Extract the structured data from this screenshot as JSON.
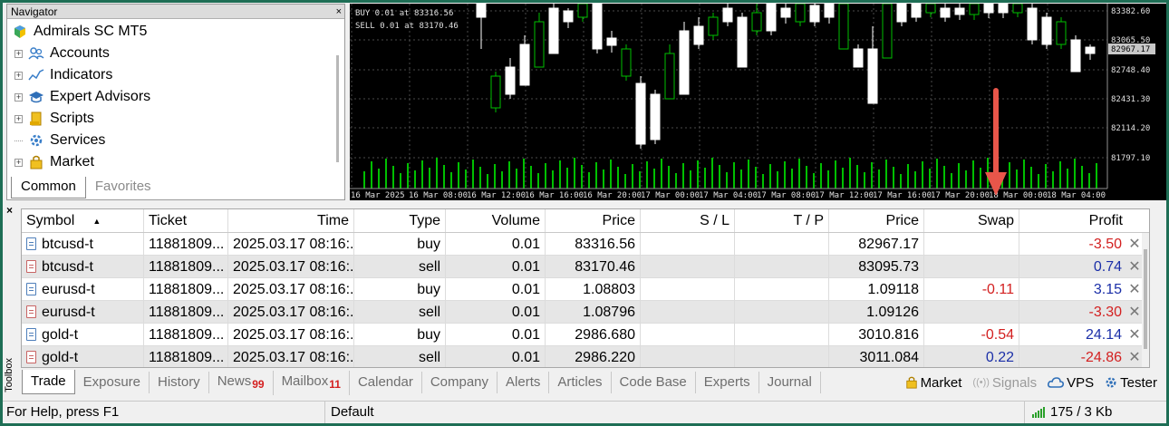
{
  "navigator": {
    "title": "Navigator",
    "close": "×",
    "root": "Admirals SC MT5",
    "items": [
      {
        "label": "Accounts",
        "icon": "accounts-icon"
      },
      {
        "label": "Indicators",
        "icon": "indicators-icon"
      },
      {
        "label": "Expert Advisors",
        "icon": "expert-advisors-icon"
      },
      {
        "label": "Scripts",
        "icon": "scripts-icon"
      },
      {
        "label": "Services",
        "icon": "services-icon"
      },
      {
        "label": "Market",
        "icon": "market-icon"
      }
    ],
    "tabs": [
      "Common",
      "Favorites"
    ]
  },
  "chart": {
    "orders": [
      "BUY 0.01 at 83316.56",
      "SELL 0.01 at 83170.46"
    ],
    "price_labels": [
      "83382.60",
      "83065.50",
      "82967.17",
      "82748.40",
      "82431.30",
      "82114.20",
      "81797.10"
    ],
    "time_labels": [
      "16 Mar 2025",
      "16 Mar 08:00",
      "16 Mar 12:00",
      "16 Mar 16:00",
      "16 Mar 20:00",
      "17 Mar 00:00",
      "17 Mar 04:00",
      "17 Mar 08:00",
      "17 Mar 12:00",
      "17 Mar 16:00",
      "17 Mar 20:00",
      "18 Mar 00:00",
      "18 Mar 04:00"
    ],
    "colors": {
      "bull": "#00c000",
      "bear": "#ffffff",
      "grid": "#4a4a4a",
      "arrow": "#e8564a"
    }
  },
  "toolbox": {
    "label": "Toolbox",
    "close": "×"
  },
  "trade": {
    "headers": {
      "symbol": "Symbol",
      "ticket": "Ticket",
      "time": "Time",
      "type": "Type",
      "volume": "Volume",
      "price": "Price",
      "sl": "S / L",
      "tp": "T / P",
      "current_price": "Price",
      "swap": "Swap",
      "profit": "Profit"
    },
    "sort_icon": "▲",
    "close_icon": "✕",
    "rows": [
      {
        "symbol": "btcusd-t",
        "ticket": "11881809...",
        "time": "2025.03.17 08:16:...",
        "type": "buy",
        "volume": "0.01",
        "price": "83316.56",
        "sl": "",
        "tp": "",
        "current": "82967.17",
        "swap": "",
        "swap_sign": "",
        "profit": "-3.50",
        "profit_sign": "neg"
      },
      {
        "symbol": "btcusd-t",
        "ticket": "11881809...",
        "time": "2025.03.17 08:16:...",
        "type": "sell",
        "volume": "0.01",
        "price": "83170.46",
        "sl": "",
        "tp": "",
        "current": "83095.73",
        "swap": "",
        "swap_sign": "",
        "profit": "0.74",
        "profit_sign": "pos"
      },
      {
        "symbol": "eurusd-t",
        "ticket": "11881809...",
        "time": "2025.03.17 08:16:...",
        "type": "buy",
        "volume": "0.01",
        "price": "1.08803",
        "sl": "",
        "tp": "",
        "current": "1.09118",
        "swap": "-0.11",
        "swap_sign": "neg",
        "profit": "3.15",
        "profit_sign": "pos"
      },
      {
        "symbol": "eurusd-t",
        "ticket": "11881809...",
        "time": "2025.03.17 08:16:...",
        "type": "sell",
        "volume": "0.01",
        "price": "1.08796",
        "sl": "",
        "tp": "",
        "current": "1.09126",
        "swap": "",
        "swap_sign": "",
        "profit": "-3.30",
        "profit_sign": "neg"
      },
      {
        "symbol": "gold-t",
        "ticket": "11881809...",
        "time": "2025.03.17 08:16:...",
        "type": "buy",
        "volume": "0.01",
        "price": "2986.680",
        "sl": "",
        "tp": "",
        "current": "3010.816",
        "swap": "-0.54",
        "swap_sign": "neg",
        "profit": "24.14",
        "profit_sign": "pos"
      },
      {
        "symbol": "gold-t",
        "ticket": "11881809...",
        "time": "2025.03.17 08:16:...",
        "type": "sell",
        "volume": "0.01",
        "price": "2986.220",
        "sl": "",
        "tp": "",
        "current": "3011.084",
        "swap": "0.22",
        "swap_sign": "pos",
        "profit": "-24.86",
        "profit_sign": "neg"
      }
    ]
  },
  "bottom_tabs": [
    {
      "label": "Trade",
      "badge": "",
      "active": true
    },
    {
      "label": "Exposure",
      "badge": ""
    },
    {
      "label": "History",
      "badge": ""
    },
    {
      "label": "News",
      "badge": "99"
    },
    {
      "label": "Mailbox",
      "badge": "11"
    },
    {
      "label": "Calendar",
      "badge": ""
    },
    {
      "label": "Company",
      "badge": ""
    },
    {
      "label": "Alerts",
      "badge": ""
    },
    {
      "label": "Articles",
      "badge": ""
    },
    {
      "label": "Code Base",
      "badge": ""
    },
    {
      "label": "Experts",
      "badge": ""
    },
    {
      "label": "Journal",
      "badge": ""
    }
  ],
  "right_tabs": {
    "market": "Market",
    "signals": "Signals",
    "vps": "VPS",
    "tester": "Tester"
  },
  "status": {
    "help": "For Help, press F1",
    "profile": "Default",
    "network": "175 / 3 Kb"
  }
}
